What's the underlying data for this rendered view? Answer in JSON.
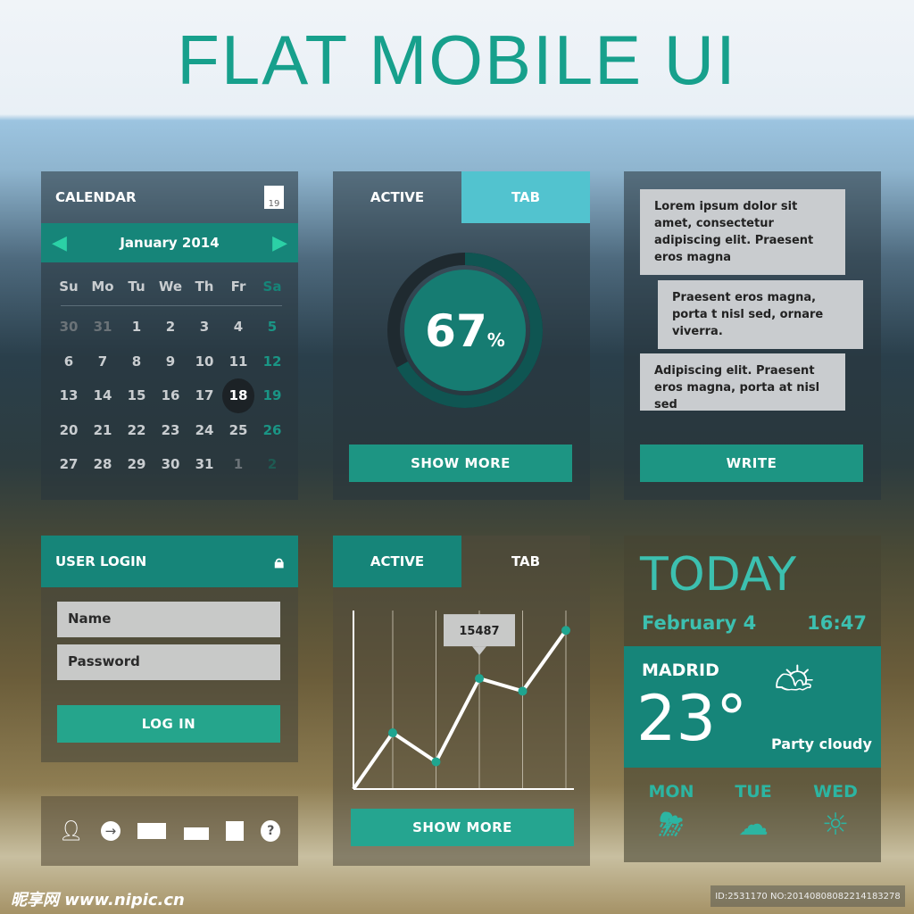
{
  "title": "FLAT MOBILE UI",
  "calendar": {
    "header": "CALENDAR",
    "icon_day": "19",
    "month": "January 2014",
    "weekdays": [
      "Su",
      "Mo",
      "Tu",
      "We",
      "Th",
      "Fr",
      "Sa"
    ],
    "days": [
      "30",
      "31",
      "1",
      "2",
      "3",
      "4",
      "5",
      "6",
      "7",
      "8",
      "9",
      "10",
      "11",
      "12",
      "13",
      "14",
      "15",
      "16",
      "17",
      "18",
      "19",
      "20",
      "21",
      "22",
      "23",
      "24",
      "25",
      "26",
      "27",
      "28",
      "29",
      "30",
      "31",
      "1",
      "2"
    ],
    "selected": "17",
    "accent": "#168579"
  },
  "progress": {
    "tab_active": "ACTIVE",
    "tab_other": "TAB",
    "value": "67",
    "unit": "%",
    "percent": 67,
    "button": "SHOW MORE"
  },
  "chat": {
    "messages": [
      "Lorem ipsum dolor sit amet, consectetur adipiscing elit. Praesent eros magna",
      "Praesent eros magna, porta t nisl sed, ornare viverra.",
      "Adipiscing elit. Praesent eros magna, porta at nisl sed"
    ],
    "button": "WRITE"
  },
  "login": {
    "header": "USER LOGIN",
    "name_placeholder": "Name",
    "password_placeholder": "Password",
    "button": "LOG IN"
  },
  "icons": [
    "user-icon",
    "arrow-right-circle-icon",
    "mail-icon",
    "inbox-icon",
    "tag-icon",
    "help-icon"
  ],
  "chart_panel": {
    "tab_active": "ACTIVE",
    "tab_other": "TAB",
    "button": "SHOW MORE"
  },
  "chart_data": {
    "type": "line",
    "x": [
      1,
      2,
      3,
      4,
      5
    ],
    "values": [
      7870,
      3810,
      15487,
      13710,
      22220
    ],
    "annotation": "15487",
    "annotation_index": 2,
    "grid": "vertical",
    "color": "#1fa590"
  },
  "weather": {
    "today": "TODAY",
    "date": "February 4",
    "time": "16:47",
    "city": "MADRID",
    "temp": "23°",
    "condition": "Party cloudy",
    "forecast": [
      {
        "day": "MON",
        "icon": "rain-sun-icon"
      },
      {
        "day": "TUE",
        "icon": "cloud-icon"
      },
      {
        "day": "WED",
        "icon": "sun-icon"
      }
    ]
  },
  "watermark": {
    "site": "昵享网 www.nipic.cn",
    "id": "ID:2531170 NO:20140808082214183278"
  }
}
